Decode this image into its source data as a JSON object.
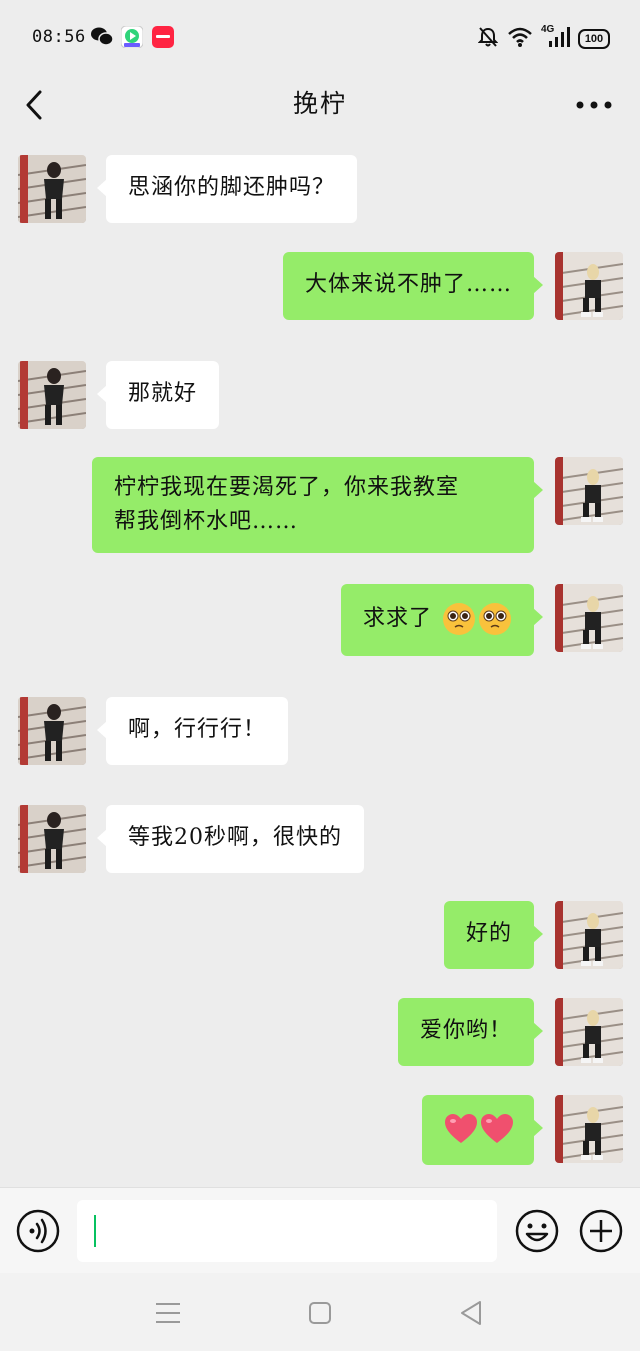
{
  "status_bar": {
    "time": "08:56",
    "network": "4G",
    "battery": "100",
    "left_icons": [
      "wechat-icon",
      "video-app-icon",
      "red-app-icon"
    ],
    "right_icons": [
      "mute-bell-icon",
      "wifi-icon",
      "signal-icon",
      "battery-icon"
    ]
  },
  "header": {
    "title": "挽柠",
    "back_icon": "chevron-left-icon",
    "more_icon": "more-dots-icon"
  },
  "messages": [
    {
      "side": "in",
      "text": "思涵你的脚还肿吗？"
    },
    {
      "side": "out",
      "text": "大体来说不肿了……"
    },
    {
      "side": "in",
      "text": "那就好"
    },
    {
      "side": "out",
      "line1": "柠柠我现在要渴死了，你来我教室",
      "line2": "帮我倒杯水吧……"
    },
    {
      "side": "out",
      "text": "求求了",
      "emojis": [
        "pleading-face-emoji",
        "pleading-face-emoji"
      ]
    },
    {
      "side": "in",
      "text": "啊，行行行！"
    },
    {
      "side": "in",
      "text": "等我20秒啊，很快的"
    },
    {
      "side": "out",
      "text": "好的"
    },
    {
      "side": "out",
      "text": "爱你哟！"
    },
    {
      "side": "out",
      "emojis": [
        "heart-emoji",
        "heart-emoji"
      ]
    }
  ],
  "input_bar": {
    "voice_icon": "voice-icon",
    "emoji_icon": "emoji-icon",
    "plus_icon": "plus-icon",
    "value": ""
  },
  "system_nav": {
    "icons": [
      "menu-icon",
      "home-icon",
      "back-triangle-icon"
    ]
  },
  "colors": {
    "background": "#ededed",
    "bubble_out": "#95ec69",
    "bubble_in": "#ffffff",
    "caret": "#07c160"
  }
}
